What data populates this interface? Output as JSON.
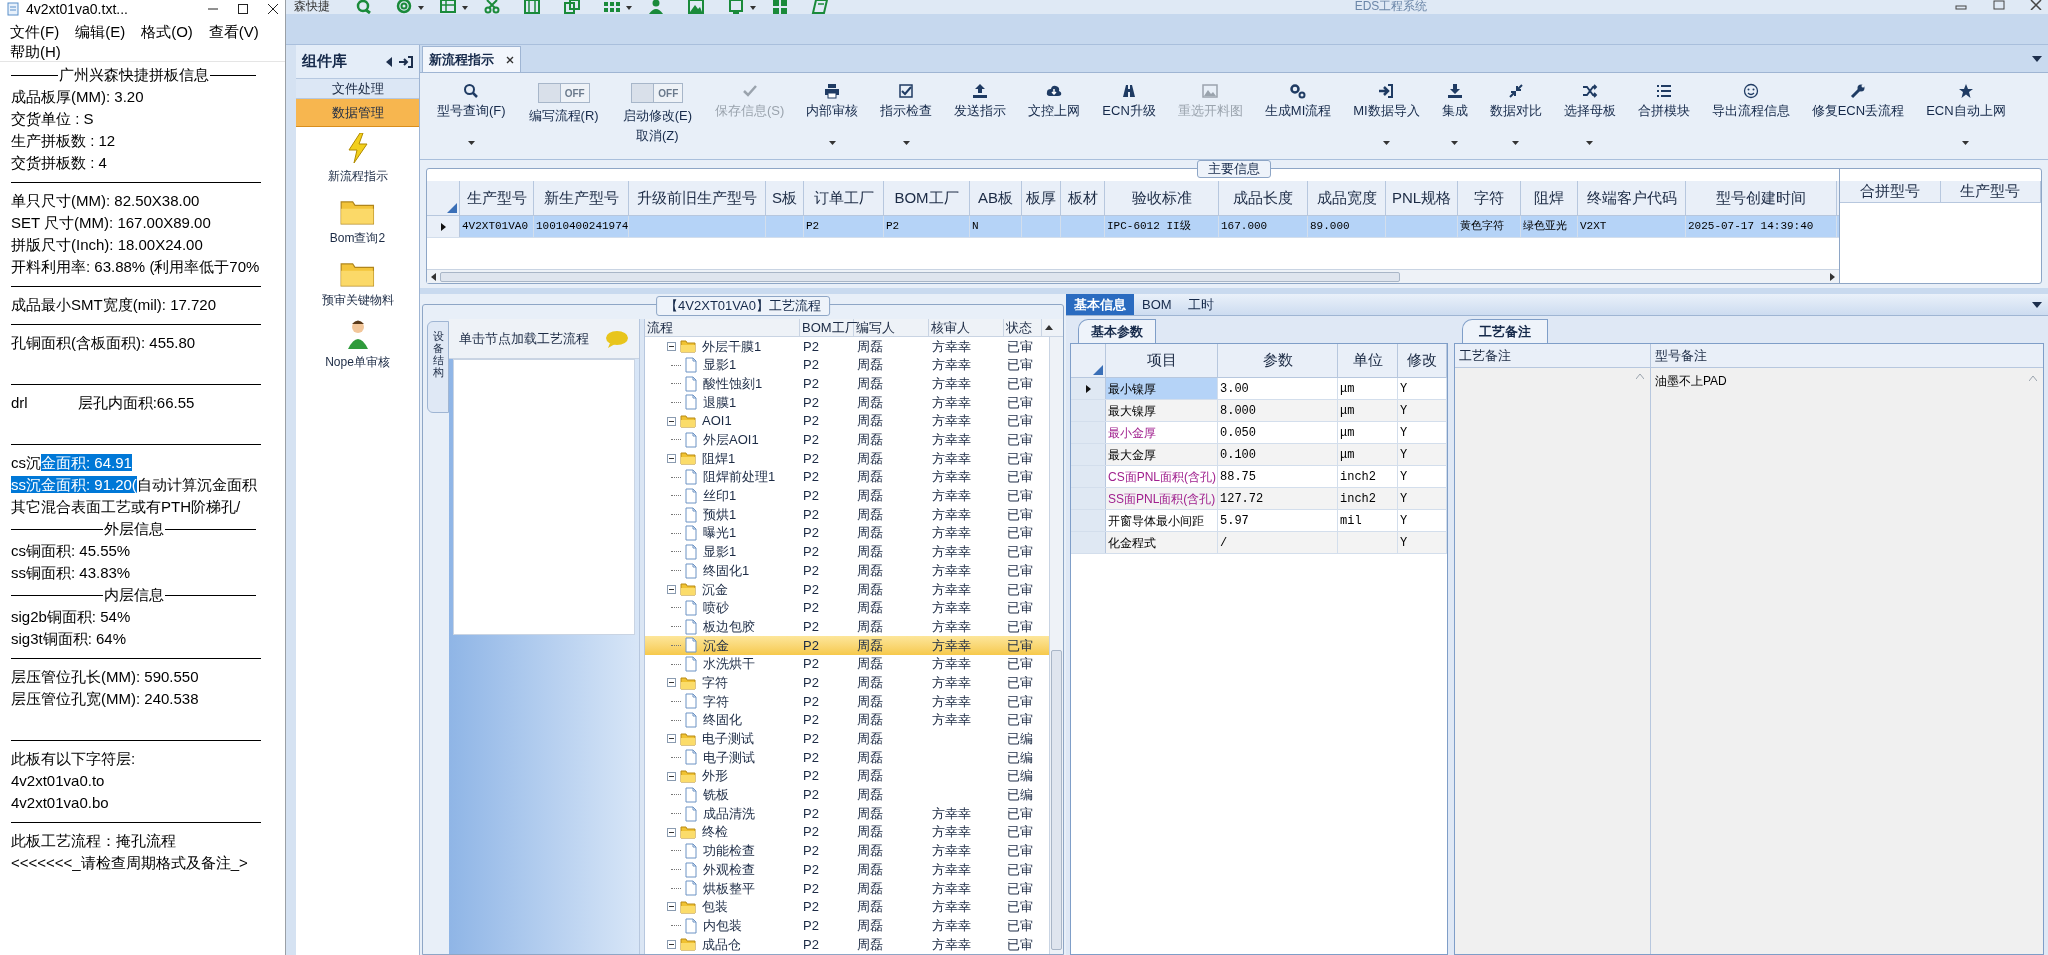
{
  "notepad": {
    "title": "4v2xt01va0.txt...",
    "menu": [
      "文件(F)",
      "编辑(E)",
      "格式(O)",
      "查看(V)",
      "帮助(H)"
    ],
    "lines": [
      {
        "kind": "heading",
        "text": "广州兴森快捷拼板信息"
      },
      {
        "kind": "text",
        "text": "成品板厚(MM): 3.20"
      },
      {
        "kind": "text",
        "text": "交货单位 : S"
      },
      {
        "kind": "text",
        "text": "生产拼板数 : 12"
      },
      {
        "kind": "text",
        "text": "交货拼板数 : 4"
      },
      {
        "kind": "rule"
      },
      {
        "kind": "text",
        "text": "单只尺寸(MM): 82.50X38.00"
      },
      {
        "kind": "text",
        "text": "SET 尺寸(MM): 167.00X89.00"
      },
      {
        "kind": "text",
        "text": "拼版尺寸(Inch): 18.00X24.00"
      },
      {
        "kind": "text",
        "text": "开料利用率: 63.88% (利用率低于70%"
      },
      {
        "kind": "rule"
      },
      {
        "kind": "text",
        "text": "成品最小SMT宽度(mil): 17.720"
      },
      {
        "kind": "rule"
      },
      {
        "kind": "text",
        "text": "孔铜面积(含板面积): 455.80"
      },
      {
        "kind": "gap"
      },
      {
        "kind": "rule"
      },
      {
        "kind": "text",
        "text": "drl            层孔内面积:66.55"
      },
      {
        "kind": "gap"
      },
      {
        "kind": "rule"
      },
      {
        "kind": "mixed",
        "segments": [
          {
            "text": "cs沉",
            "selected": false
          },
          {
            "text": "金面积: 64.91",
            "selected": true
          }
        ]
      },
      {
        "kind": "mixed",
        "segments": [
          {
            "text": "ss沉金面积: 91.20(",
            "selected": true
          },
          {
            "text": "自动计算沉金面积",
            "selected": false
          }
        ]
      },
      {
        "kind": "text",
        "text": "其它混合表面工艺或有PTH阶梯孔/"
      },
      {
        "kind": "heading",
        "text": "外层信息"
      },
      {
        "kind": "text",
        "text": "cs铜面积: 45.55%"
      },
      {
        "kind": "text",
        "text": "ss铜面积: 43.83%"
      },
      {
        "kind": "heading",
        "text": "内层信息"
      },
      {
        "kind": "text",
        "text": "sig2b铜面积: 54%"
      },
      {
        "kind": "text",
        "text": "sig3t铜面积: 64%"
      },
      {
        "kind": "rule"
      },
      {
        "kind": "text",
        "text": "层压管位孔长(MM): 590.550"
      },
      {
        "kind": "text",
        "text": "层压管位孔宽(MM): 240.538"
      },
      {
        "kind": "gap"
      },
      {
        "kind": "rule"
      },
      {
        "kind": "text",
        "text": "此板有以下字符层:"
      },
      {
        "kind": "text",
        "text": "4v2xt01va0.to"
      },
      {
        "kind": "text",
        "text": "4v2xt01va0.bo"
      },
      {
        "kind": "rule"
      },
      {
        "kind": "text",
        "text": "此板工艺流程：掩孔流程"
      },
      {
        "kind": "text",
        "text": "<<<<<<<_请检查周期格式及备注_>"
      }
    ]
  },
  "app": {
    "brand": "森快捷",
    "title": "EDS工程系统",
    "sidebar": {
      "title": "组件库",
      "sections": [
        {
          "label": "文件处理",
          "selected": false
        },
        {
          "label": "数据管理",
          "selected": true
        }
      ],
      "items": [
        "新流程指示",
        "Bom查询2",
        "预审关键物料",
        "Nope单审核"
      ]
    },
    "tabs": [
      {
        "label": "新流程指示",
        "selected": true
      }
    ],
    "toolbar": [
      {
        "kind": "button",
        "label": "型号查询(F)",
        "dropdown": true,
        "disabled": false
      },
      {
        "kind": "toggle",
        "state_label": "OFF",
        "on": false,
        "label": "编写流程(R)"
      },
      {
        "kind": "toggle",
        "state_label": "OFF",
        "on": false,
        "label": "启动修改(E)",
        "second_label": "取消(Z)"
      },
      {
        "kind": "button",
        "label": "保存信息(S)",
        "dropdown": false,
        "disabled": true
      },
      {
        "kind": "button",
        "label": "内部审核",
        "dropdown": true,
        "disabled": false
      },
      {
        "kind": "button",
        "label": "指示检查",
        "dropdown": true,
        "disabled": false
      },
      {
        "kind": "button",
        "label": "发送指示",
        "dropdown": false,
        "disabled": false
      },
      {
        "kind": "button",
        "label": "文控上网",
        "dropdown": false,
        "disabled": false
      },
      {
        "kind": "button",
        "label": "ECN升级",
        "dropdown": false,
        "disabled": false
      },
      {
        "kind": "button",
        "label": "重选开料图",
        "dropdown": false,
        "disabled": true
      },
      {
        "kind": "button",
        "label": "生成MI流程",
        "dropdown": false,
        "disabled": false
      },
      {
        "kind": "button",
        "label": "MI数据导入",
        "dropdown": true,
        "disabled": false
      },
      {
        "kind": "button",
        "label": "集成",
        "dropdown": true,
        "disabled": false
      },
      {
        "kind": "button",
        "label": "数据对比",
        "dropdown": true,
        "disabled": false
      },
      {
        "kind": "button",
        "label": "选择母板",
        "dropdown": true,
        "disabled": false
      },
      {
        "kind": "button",
        "label": "合拼模块",
        "dropdown": false,
        "disabled": false
      },
      {
        "kind": "button",
        "label": "导出流程信息",
        "dropdown": false,
        "disabled": false
      },
      {
        "kind": "button",
        "label": "修复ECN丢流程",
        "dropdown": false,
        "disabled": false
      },
      {
        "kind": "button",
        "label": "ECN自动上网",
        "dropdown": true,
        "disabled": false
      }
    ],
    "main_info": {
      "title": "主要信息",
      "columns": [
        "生产型号",
        "新生产型号",
        "升级前旧生产型号",
        "S板",
        "订单工厂",
        "BOM工厂",
        "AB板",
        "板厚",
        "板材",
        "验收标准",
        "成品长度",
        "成品宽度",
        "PNL规格",
        "字符",
        "阻焊",
        "终端客户代码",
        "型号创建时间"
      ],
      "rows": [
        {
          "selected": true,
          "cells": [
            "4V2XT01VA0",
            "10010400241974",
            null,
            null,
            "P2",
            "P2",
            "N",
            null,
            null,
            "IPC-6012 II级",
            "167.000",
            "89.000",
            null,
            "黄色字符",
            "绿色亚光",
            "V2XT",
            "2025-07-17 14:39:40"
          ]
        }
      ],
      "side_columns": [
        "合拼型号",
        "生产型号"
      ]
    },
    "process": {
      "title": "【4V2XT01VA0】工艺流程",
      "side_tab": "设备结构",
      "hint": "单击节点加载工艺流程",
      "columns": [
        "流程",
        "BOM工厂",
        "编写人",
        "核审人",
        "状态"
      ],
      "tree": [
        {
          "label": "外层干膜1",
          "factory": "P2",
          "writer": "周磊",
          "reviewer": "方幸幸",
          "status": "已审",
          "selected": false,
          "expanded": true,
          "children": [
            {
              "label": "显影1",
              "factory": "P2",
              "writer": "周磊",
              "reviewer": "方幸幸",
              "status": "已审",
              "selected": false
            },
            {
              "label": "酸性蚀刻1",
              "factory": "P2",
              "writer": "周磊",
              "reviewer": "方幸幸",
              "status": "已审",
              "selected": false
            },
            {
              "label": "退膜1",
              "factory": "P2",
              "writer": "周磊",
              "reviewer": "方幸幸",
              "status": "已审",
              "selected": false
            }
          ]
        },
        {
          "label": "AOI1",
          "factory": "P2",
          "writer": "周磊",
          "reviewer": "方幸幸",
          "status": "已审",
          "selected": false,
          "expanded": true,
          "children": [
            {
              "label": "外层AOI1",
              "factory": "P2",
              "writer": "周磊",
              "reviewer": "方幸幸",
              "status": "已审",
              "selected": false
            }
          ]
        },
        {
          "label": "阻焊1",
          "factory": "P2",
          "writer": "周磊",
          "reviewer": "方幸幸",
          "status": "已审",
          "selected": false,
          "expanded": true,
          "children": [
            {
              "label": "阻焊前处理1",
              "factory": "P2",
              "writer": "周磊",
              "reviewer": "方幸幸",
              "status": "已审",
              "selected": false
            },
            {
              "label": "丝印1",
              "factory": "P2",
              "writer": "周磊",
              "reviewer": "方幸幸",
              "status": "已审",
              "selected": false
            },
            {
              "label": "预烘1",
              "factory": "P2",
              "writer": "周磊",
              "reviewer": "方幸幸",
              "status": "已审",
              "selected": false
            },
            {
              "label": "曝光1",
              "factory": "P2",
              "writer": "周磊",
              "reviewer": "方幸幸",
              "status": "已审",
              "selected": false
            },
            {
              "label": "显影1",
              "factory": "P2",
              "writer": "周磊",
              "reviewer": "方幸幸",
              "status": "已审",
              "selected": false
            },
            {
              "label": "终固化1",
              "factory": "P2",
              "writer": "周磊",
              "reviewer": "方幸幸",
              "status": "已审",
              "selected": false
            }
          ]
        },
        {
          "label": "沉金",
          "factory": "P2",
          "writer": "周磊",
          "reviewer": "方幸幸",
          "status": "已审",
          "selected": false,
          "expanded": true,
          "children": [
            {
              "label": "喷砂",
              "factory": "P2",
              "writer": "周磊",
              "reviewer": "方幸幸",
              "status": "已审",
              "selected": false
            },
            {
              "label": "板边包胶",
              "factory": "P2",
              "writer": "周磊",
              "reviewer": "方幸幸",
              "status": "已审",
              "selected": false
            },
            {
              "label": "沉金",
              "factory": "P2",
              "writer": "周磊",
              "reviewer": "方幸幸",
              "status": "已审",
              "selected": true
            },
            {
              "label": "水洗烘干",
              "factory": "P2",
              "writer": "周磊",
              "reviewer": "方幸幸",
              "status": "已审",
              "selected": false
            }
          ]
        },
        {
          "label": "字符",
          "factory": "P2",
          "writer": "周磊",
          "reviewer": "方幸幸",
          "status": "已审",
          "selected": false,
          "expanded": true,
          "children": [
            {
              "label": "字符",
              "factory": "P2",
              "writer": "周磊",
              "reviewer": "方幸幸",
              "status": "已审",
              "selected": false
            },
            {
              "label": "终固化",
              "factory": "P2",
              "writer": "周磊",
              "reviewer": "方幸幸",
              "status": "已审",
              "selected": false
            }
          ]
        },
        {
          "label": "电子测试",
          "factory": "P2",
          "writer": "周磊",
          "status": "已编",
          "selected": false,
          "expanded": true,
          "children": [
            {
              "label": "电子测试",
              "factory": "P2",
              "writer": "周磊",
              "status": "已编",
              "selected": false
            }
          ]
        },
        {
          "label": "外形",
          "factory": "P2",
          "writer": "周磊",
          "status": "已编",
          "selected": false,
          "expanded": true,
          "children": [
            {
              "label": "铣板",
              "factory": "P2",
              "writer": "周磊",
              "status": "已编",
              "selected": false
            },
            {
              "label": "成品清洗",
              "factory": "P2",
              "writer": "周磊",
              "reviewer": "方幸幸",
              "status": "已审",
              "selected": false
            }
          ]
        },
        {
          "label": "终检",
          "factory": "P2",
          "writer": "周磊",
          "reviewer": "方幸幸",
          "status": "已审",
          "selected": false,
          "expanded": true,
          "children": [
            {
              "label": "功能检查",
              "factory": "P2",
              "writer": "周磊",
              "reviewer": "方幸幸",
              "status": "已审",
              "selected": false
            },
            {
              "label": "外观检查",
              "factory": "P2",
              "writer": "周磊",
              "reviewer": "方幸幸",
              "status": "已审",
              "selected": false
            },
            {
              "label": "烘板整平",
              "factory": "P2",
              "writer": "周磊",
              "reviewer": "方幸幸",
              "status": "已审",
              "selected": false
            }
          ]
        },
        {
          "label": "包装",
          "factory": "P2",
          "writer": "周磊",
          "reviewer": "方幸幸",
          "status": "已审",
          "selected": false,
          "expanded": true,
          "children": [
            {
              "label": "内包装",
              "factory": "P2",
              "writer": "周磊",
              "reviewer": "方幸幸",
              "status": "已审",
              "selected": false
            }
          ]
        },
        {
          "label": "成品仓",
          "factory": "P2",
          "writer": "周磊",
          "reviewer": "方幸幸",
          "status": "已审",
          "selected": false,
          "expanded": true
        }
      ]
    },
    "detail": {
      "tabs": [
        {
          "label": "基本信息",
          "selected": true
        },
        {
          "label": "BOM",
          "selected": false
        },
        {
          "label": "工时",
          "selected": false
        }
      ],
      "params": {
        "tab": "基本参数",
        "columns": [
          "项目",
          "参数",
          "单位",
          "修改"
        ],
        "rows": [
          {
            "item": "最小镍厚",
            "value": "3.00",
            "unit": "μm",
            "modified": "Y",
            "highlighted": false,
            "selected": true
          },
          {
            "item": "最大镍厚",
            "value": "8.000",
            "unit": "μm",
            "modified": "Y",
            "highlighted": false,
            "selected": false
          },
          {
            "item": "最小金厚",
            "value": "0.050",
            "unit": "μm",
            "modified": "Y",
            "highlighted": true,
            "selected": false
          },
          {
            "item": "最大金厚",
            "value": "0.100",
            "unit": "μm",
            "modified": "Y",
            "highlighted": false,
            "selected": false
          },
          {
            "item": "CS面PNL面积(含孔)",
            "value": "88.75",
            "unit": "inch2",
            "modified": "Y",
            "highlighted": true,
            "selected": false
          },
          {
            "item": "SS面PNL面积(含孔)",
            "value": "127.72",
            "unit": "inch2",
            "modified": "Y",
            "highlighted": true,
            "selected": false
          },
          {
            "item": "开窗导体最小间距",
            "value": "5.97",
            "unit": "mil",
            "modified": "Y",
            "highlighted": false,
            "selected": false
          },
          {
            "item": "化金程式",
            "value": "/",
            "modified": "Y",
            "highlighted": false,
            "selected": false
          }
        ]
      },
      "notes": {
        "tab": "工艺备注",
        "columns": [
          "工艺备注",
          "型号备注"
        ],
        "model_note": "油墨不上PAD"
      }
    }
  }
}
